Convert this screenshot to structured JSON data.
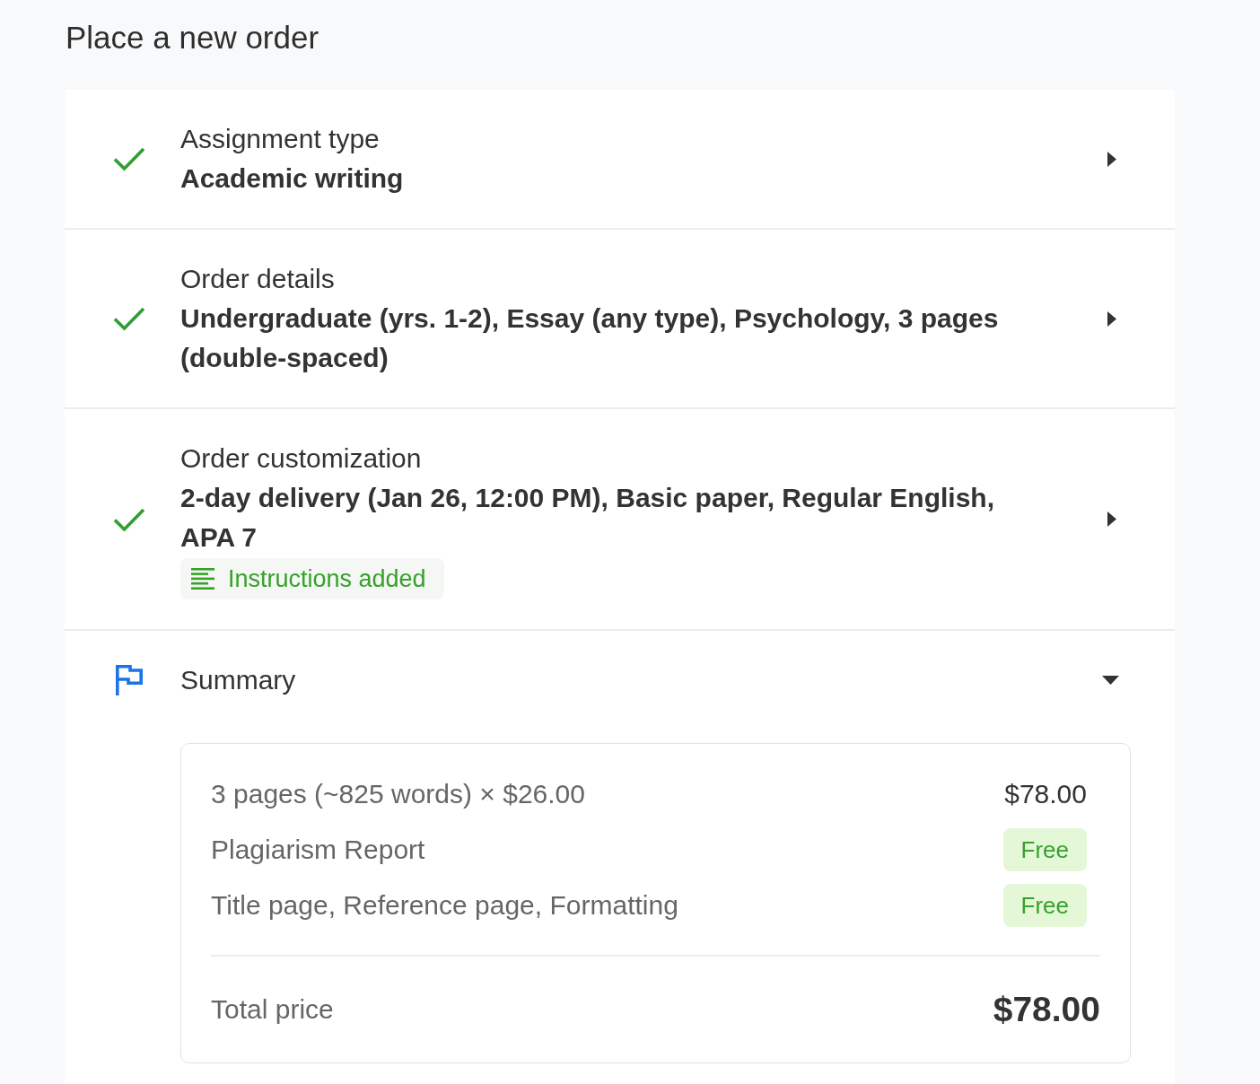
{
  "page": {
    "title": "Place a new order"
  },
  "steps": [
    {
      "label": "Assignment type",
      "value": "Academic writing",
      "completed": true,
      "expanded": false
    },
    {
      "label": "Order details",
      "value": "Undergraduate (yrs. 1-2), Essay (any type), Psychology, 3 pages (double-spaced)",
      "completed": true,
      "expanded": false
    },
    {
      "label": "Order customization",
      "value": "2-day delivery (Jan 26, 12:00 PM), Basic paper, Regular English, APA 7",
      "completed": true,
      "expanded": false,
      "badge": "Instructions added"
    }
  ],
  "summary": {
    "label": "Summary",
    "expanded": true,
    "lines": [
      {
        "kind": "price",
        "text": "3 pages (~825 words) × $26.00",
        "amount": "$78.00"
      },
      {
        "kind": "free",
        "text": "Plagiarism Report",
        "amount": "Free"
      },
      {
        "kind": "free",
        "text": "Title page, Reference page, Formatting",
        "amount": "Free"
      }
    ],
    "total": {
      "label": "Total price",
      "amount": "$78.00"
    }
  }
}
